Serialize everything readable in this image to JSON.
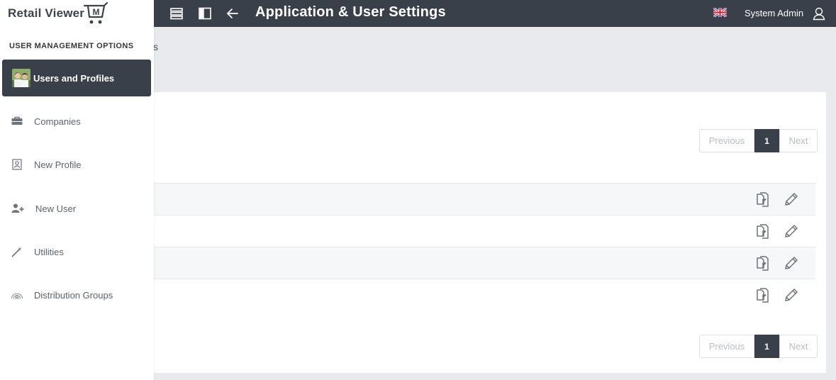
{
  "app": {
    "logo_text": "Retail Viewer",
    "logo_badge": "M"
  },
  "header": {
    "title": "Application & User Settings",
    "user_name": "System Admin",
    "icons": [
      "list-icon",
      "sidebar-toggle-icon",
      "back-arrow-icon",
      "uk-flag-icon",
      "user-icon"
    ]
  },
  "background": {
    "breadcrumb_peek": "s",
    "pagination_top": {
      "previous": "Previous",
      "page": "1",
      "next": "Next"
    },
    "pagination_bottom": {
      "previous": "Previous",
      "page": "1",
      "next": "Next"
    },
    "row_actions": [
      "copy-icon",
      "edit-pencil-icon"
    ],
    "row_count": 4
  },
  "sidebar": {
    "section_title": "USER MANAGEMENT OPTIONS",
    "active_item": {
      "label": "Users and Profiles",
      "icon": "users-avatar-icon"
    },
    "items": [
      {
        "label": "Companies",
        "icon": "briefcase-icon"
      },
      {
        "label": "New Profile",
        "icon": "profile-card-icon"
      },
      {
        "label": "New User",
        "icon": "add-user-icon"
      },
      {
        "label": "Utilities",
        "icon": "magic-wand-icon"
      },
      {
        "label": "Distribution Groups",
        "icon": "distribution-icon"
      }
    ]
  },
  "colors": {
    "topbar": "#3a4049",
    "page_bg": "#e9eaee",
    "active_nav": "#3a4049"
  }
}
